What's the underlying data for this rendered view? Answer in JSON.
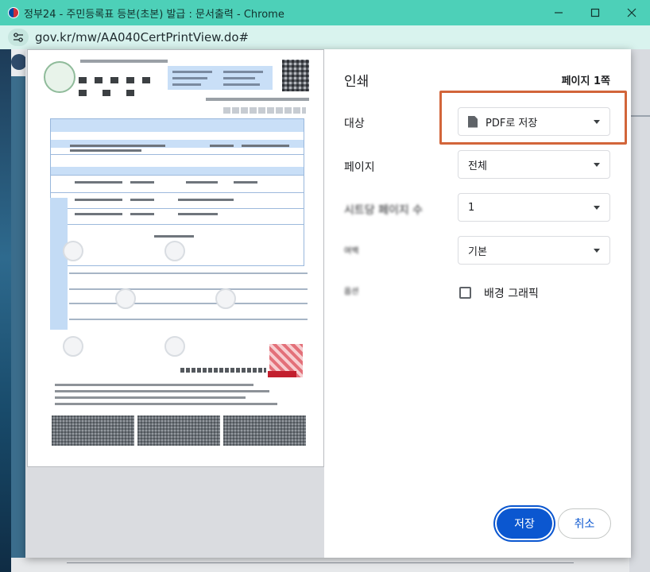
{
  "window": {
    "title": "정부24 - 주민등록표 등본(초본) 발급 : 문서출력 - Chrome",
    "minimize_icon": "minimize-icon",
    "maximize_icon": "maximize-icon",
    "close_icon": "close-icon"
  },
  "address_bar": {
    "url": "gov.kr/mw/AA040CertPrintView.do#",
    "site_info_icon": "tune-icon"
  },
  "print_dialog": {
    "heading": "인쇄",
    "page_count": "페이지 1쪽",
    "destination": {
      "label": "대상",
      "value": "PDF로 저장",
      "icon": "file-icon"
    },
    "pages": {
      "label": "페이지",
      "value": "전체"
    },
    "pages_per_sheet": {
      "label": "시트당 페이지 수",
      "value": "1"
    },
    "margins": {
      "label": "여백",
      "value": "기본"
    },
    "options": {
      "label": "옵션",
      "background_graphics": "배경 그래픽",
      "background_graphics_checked": false
    },
    "buttons": {
      "save": "저장",
      "cancel": "취소"
    },
    "colors": {
      "primary": "#0b57d0",
      "highlight_box": "#d2653a",
      "titlebar": "#4dd0b8"
    }
  }
}
